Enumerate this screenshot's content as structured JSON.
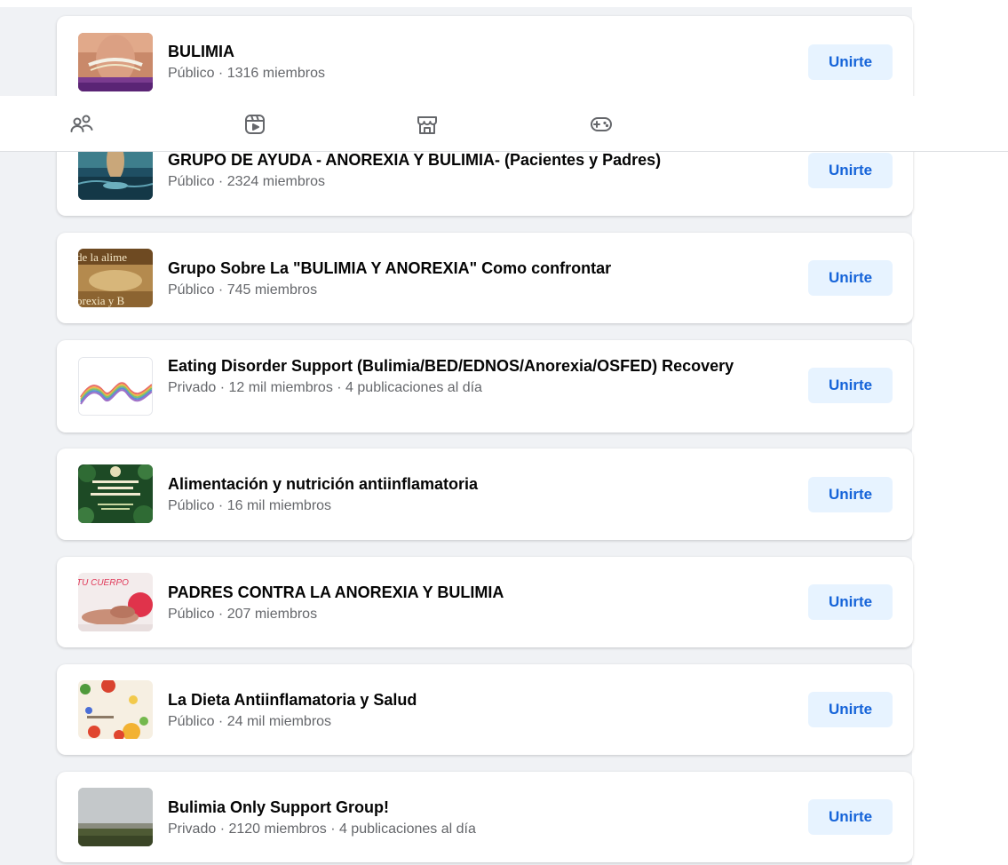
{
  "groups": [
    {
      "name": "BULIMIA",
      "meta": "Público · 1316 miembros",
      "join_label": "Unirte",
      "icon": "group-photo-waist-measure"
    },
    {
      "name": "GRUPO DE AYUDA - ANOREXIA Y BULIMIA- (Pacientes y Padres)",
      "meta": "Público · 2324 miembros",
      "join_label": "Unirte",
      "icon": "group-photo-figure-water"
    },
    {
      "name": "Grupo Sobre La \"BULIMIA Y ANOREXIA\" Como confrontar",
      "meta": "Público · 745 miembros",
      "join_label": "Unirte",
      "icon": "group-photo-text-banner"
    },
    {
      "name": "Eating Disorder Support (Bulimia/BED/EDNOS/Anorexia/OSFED) Recovery",
      "meta": "Privado · 12 mil miembros · 4 publicaciones al día",
      "join_label": "Unirte",
      "icon": "group-photo-rainbow-wave"
    },
    {
      "name": "Alimentación y nutrición antiinflamatoria",
      "meta": "Público · 16 mil miembros",
      "join_label": "Unirte",
      "icon": "group-photo-green-poster"
    },
    {
      "name": "PADRES CONTRA LA ANOREXIA Y BULIMIA",
      "meta": "Público · 207 miembros",
      "join_label": "Unirte",
      "icon": "group-photo-tu-cuerpo"
    },
    {
      "name": "La Dieta Antiinflamatoria y Salud",
      "meta": "Público · 24 mil miembros",
      "join_label": "Unirte",
      "icon": "group-photo-fruits"
    },
    {
      "name": "Bulimia Only Support Group!",
      "meta": "Privado · 2120 miembros · 4 publicaciones al día",
      "join_label": "Unirte",
      "icon": "group-photo-landscape"
    }
  ],
  "thumb_texts": {
    "group3_top": "de la alime",
    "group3_bottom": "orexia y B",
    "group6_text": "TU CUERPO"
  },
  "nav": {
    "icons": [
      "groups-icon",
      "video-icon",
      "marketplace-icon",
      "gaming-icon"
    ]
  },
  "colors": {
    "join_bg": "#e7f3ff",
    "join_text": "#1664d9",
    "meta_text": "#65676b",
    "page_bg": "#f0f2f5"
  }
}
